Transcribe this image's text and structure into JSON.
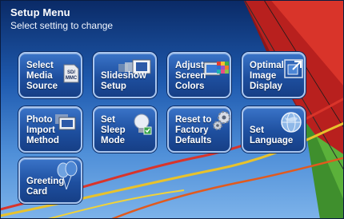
{
  "header": {
    "title": "Setup Menu",
    "subtitle": "Select setting to change"
  },
  "tiles": [
    {
      "label": "Select\nMedia\nSource",
      "icon": "sd-card-icon",
      "badge": "SD/\nMMC"
    },
    {
      "label": "Slideshow\nSetup",
      "icon": "slideshow-icon"
    },
    {
      "label": "Adjust\nScreen\nColors",
      "icon": "color-palette-icon"
    },
    {
      "label": "Optimal\nImage\nDisplay",
      "icon": "resize-image-icon"
    },
    {
      "label": "Photo\nImport\nMethod",
      "icon": "photo-stack-icon"
    },
    {
      "label": "Set\nSleep\nMode",
      "icon": "lightbulb-icon"
    },
    {
      "label": "Reset to\nFactory\nDefaults",
      "icon": "gears-icon"
    },
    {
      "label": "Set\nLanguage",
      "icon": "globe-icon"
    },
    {
      "label": "Greeting\nCard",
      "icon": "balloons-icon"
    }
  ],
  "colors": {
    "sky_top": "#0a2a66",
    "sky_bottom": "#7db3ea",
    "tile_fill": "#1e4f9f",
    "tile_border": "#a9c6ef"
  }
}
